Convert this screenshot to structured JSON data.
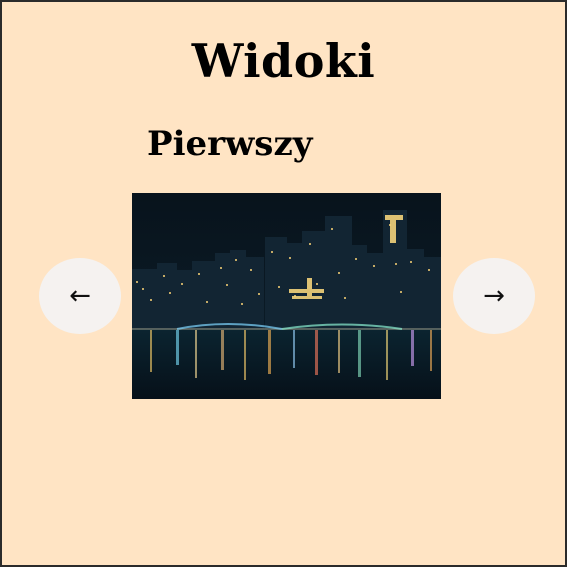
{
  "page": {
    "title": "Widoki",
    "background_color": "#ffe4c4",
    "border_color": "#2b2b2b"
  },
  "carousel": {
    "slide_title": "Pierwszy",
    "prev_button_label": "←",
    "next_button_label": "→",
    "prev_icon": "arrow-left-icon",
    "next_icon": "arrow-right-icon",
    "button_color": "#f5f2f0"
  },
  "image": {
    "alt": "night-city-skyline"
  }
}
